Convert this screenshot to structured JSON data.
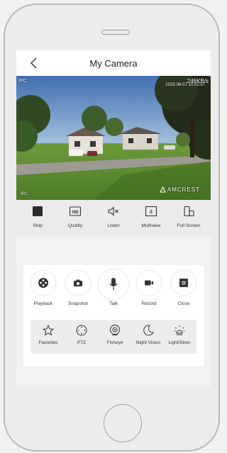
{
  "header": {
    "title": "My Camera"
  },
  "video": {
    "top_left": "IPC",
    "bitrate": "246KB/s",
    "timestamp": "2023-06-07 10:02:57",
    "bottom_left": "IPC",
    "brand": "AMCREST"
  },
  "controls": [
    {
      "label": "Stop",
      "icon": "stop-icon"
    },
    {
      "label": "Quality",
      "icon": "hd-icon"
    },
    {
      "label": "Listen",
      "icon": "speaker-muted-icon"
    },
    {
      "label": "Multiview",
      "icon": "multiview-4-icon"
    },
    {
      "label": "Full Screen",
      "icon": "fullscreen-icon"
    }
  ],
  "actions": [
    {
      "label": "Playback",
      "icon": "playback-icon"
    },
    {
      "label": "Snapshot",
      "icon": "camera-icon"
    },
    {
      "label": "Talk",
      "icon": "microphone-icon"
    },
    {
      "label": "Record",
      "icon": "video-record-icon"
    },
    {
      "label": "Close",
      "icon": "close-icon"
    }
  ],
  "tools": [
    {
      "label": "Favorites",
      "icon": "star-icon"
    },
    {
      "label": "PTZ",
      "icon": "ptz-icon"
    },
    {
      "label": "Fisheye",
      "icon": "fisheye-icon"
    },
    {
      "label": "Night Vision",
      "icon": "moon-icon"
    },
    {
      "label": "Light/Siren",
      "icon": "light-icon"
    }
  ],
  "multiview_count": "4",
  "quality_badge": "HD"
}
